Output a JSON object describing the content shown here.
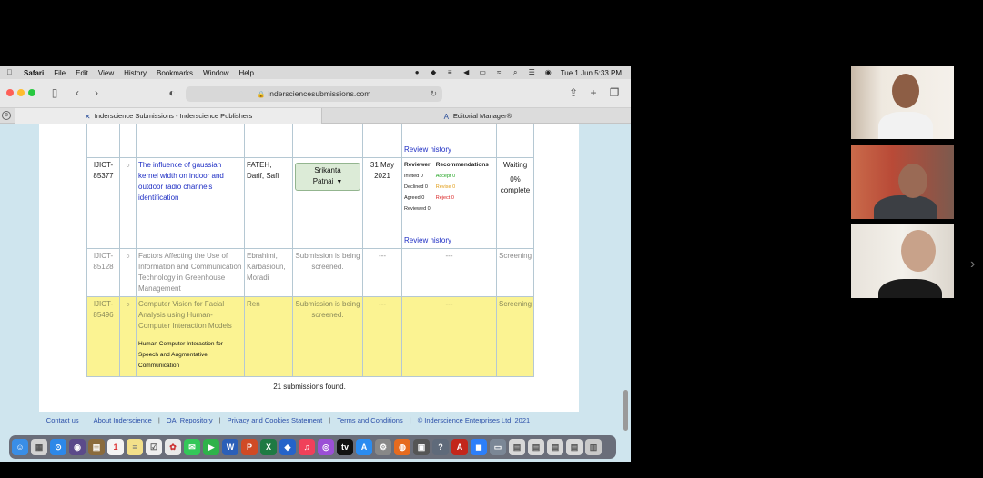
{
  "menubar": {
    "apple": "",
    "app": "Safari",
    "items": [
      "File",
      "Edit",
      "View",
      "History",
      "Bookmarks",
      "Window",
      "Help"
    ],
    "clock": "Tue 1 Jun  5:33 PM"
  },
  "toolbar": {
    "url": "indersciencesubmissions.com"
  },
  "tabs": [
    {
      "label": "Inderscience Submissions - Inderscience Publishers",
      "active": true
    },
    {
      "label": "Editorial Manager®",
      "active": false
    }
  ],
  "table": {
    "top_row": {
      "review_link": "Review history"
    },
    "rows": [
      {
        "id": "IJICT-85377",
        "marker": "○",
        "title": "The influence of gaussian kernel width on indoor and outdoor radio channels identification",
        "authors": "FATEH, Darif, Safi",
        "editor": "Srikanta Patnai",
        "date": "31 May 2021",
        "reviewers_header": "Reviewer",
        "reviewers": [
          "Invited 0",
          "Declined 0",
          "Agreed 0",
          "Reviewed 0"
        ],
        "recommendations_header": "Recommendations",
        "recommendations": [
          "Accept 0",
          "Revise 0",
          "Reject 0"
        ],
        "review_link": "Review history",
        "status": "Waiting",
        "progress": "0% complete"
      },
      {
        "id": "IJICT-85128",
        "marker": "○",
        "title": "Factors Affecting the Use of Information and Communication Technology in Greenhouse Management",
        "authors": "Ebrahimi, Karbasioun, Moradi",
        "editor": "Submission is being screened.",
        "date": "---",
        "review": "---",
        "status": "Screening"
      },
      {
        "id": "IJICT-85496",
        "marker": "○",
        "title": "Computer Vision for Facial Analysis using Human-Computer Interaction Models",
        "keywords": "Human Computer Interaction for Speech and Augmentative Communication",
        "authors": "Ren",
        "editor": "Submission is being screened.",
        "date": "---",
        "review": "---",
        "status": "Screening"
      }
    ],
    "found": "21 submissions found."
  },
  "footer": {
    "links": [
      "Contact us",
      "About Inderscience",
      "OAI Repository",
      "Privacy and Cookies Statement",
      "Terms and Conditions"
    ],
    "separator": "|",
    "copyright": "© Inderscience Enterprises Ltd. 2021"
  },
  "colors": {
    "highlight_row": "#fbf392",
    "link": "#1f2fc4",
    "accept": "#1fa31f",
    "revise": "#e09b12",
    "reject": "#d92222"
  }
}
